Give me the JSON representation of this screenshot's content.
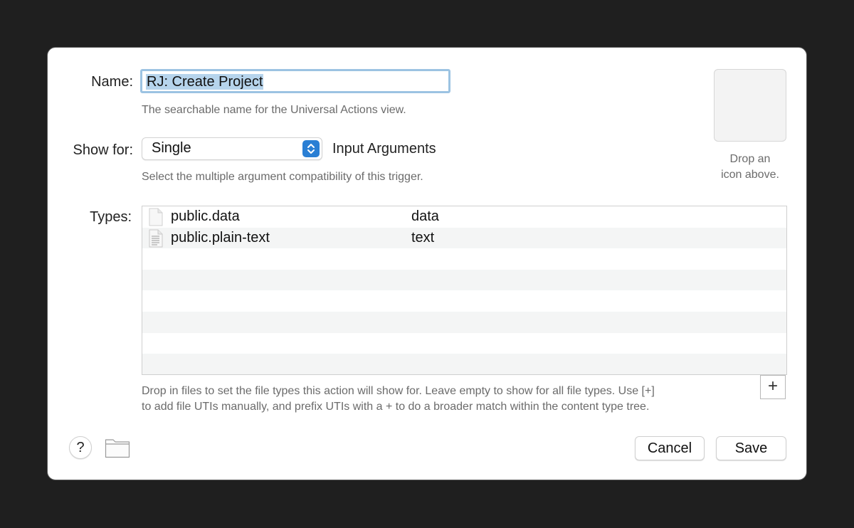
{
  "form": {
    "name_label": "Name:",
    "name_value": "RJ: Create Project",
    "name_help": "The searchable name for the Universal Actions view.",
    "show_for_label": "Show for:",
    "show_for_value": "Single",
    "show_for_suffix": "Input Arguments",
    "show_for_help": "Select the multiple argument compatibility of this trigger.",
    "types_label": "Types:"
  },
  "icon_drop": {
    "line1": "Drop an",
    "line2": "icon above."
  },
  "types": [
    {
      "uti": "public.data",
      "kind": "data",
      "icon": "blank-document-icon"
    },
    {
      "uti": "public.plain-text",
      "kind": "text",
      "icon": "text-document-icon"
    }
  ],
  "types_help": {
    "line1": "Drop in files to set the file types this action will show for. Leave empty to show for all file types. Use [+]",
    "line2": "to add file UTIs manually, and prefix UTIs with a + to do a broader match within the content type tree."
  },
  "buttons": {
    "add": "+",
    "help": "?",
    "cancel": "Cancel",
    "save": "Save"
  },
  "colors": {
    "window_bg": "#1f1f1f",
    "dialog_bg": "#ffffff",
    "accent": "#2a7fd4",
    "focus_ring": "#9cc3e2",
    "selection": "#b6d4ec"
  }
}
